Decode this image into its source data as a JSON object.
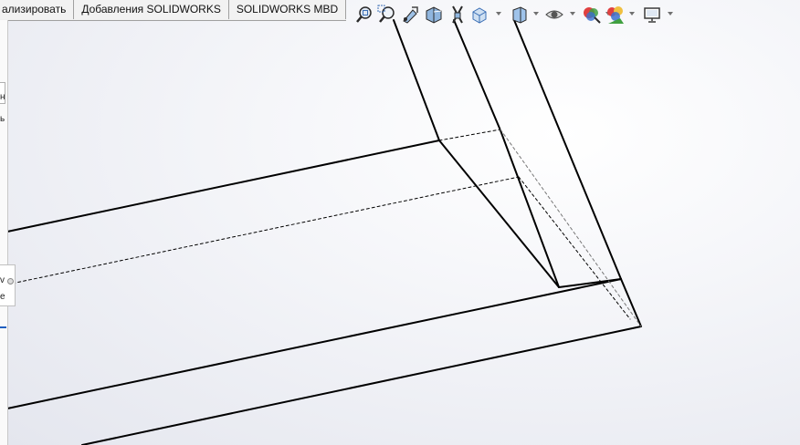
{
  "tabs": [
    {
      "label": "ализировать"
    },
    {
      "label": "Добавления SOLIDWORKS"
    },
    {
      "label": "SOLIDWORKS MBD"
    }
  ],
  "left_panel": {
    "char_1": "н",
    "char_2": "ь",
    "char_3": "v",
    "char_4": "e"
  },
  "toolbar": {
    "icons": [
      "zoom-to-fit-icon",
      "zoom-area-icon",
      "previous-view-icon",
      "section-view-icon",
      "dynamic-annotation-icon",
      "view-orientation-icon",
      "display-style-icon",
      "hide-show-items-icon",
      "edit-appearance-icon",
      "apply-scene-icon",
      "view-settings-icon"
    ]
  },
  "colors": {
    "edge": "#000000",
    "hidden_edge": "#222222",
    "background_top": "#ffffff",
    "background_edge": "#e4e6ee"
  }
}
